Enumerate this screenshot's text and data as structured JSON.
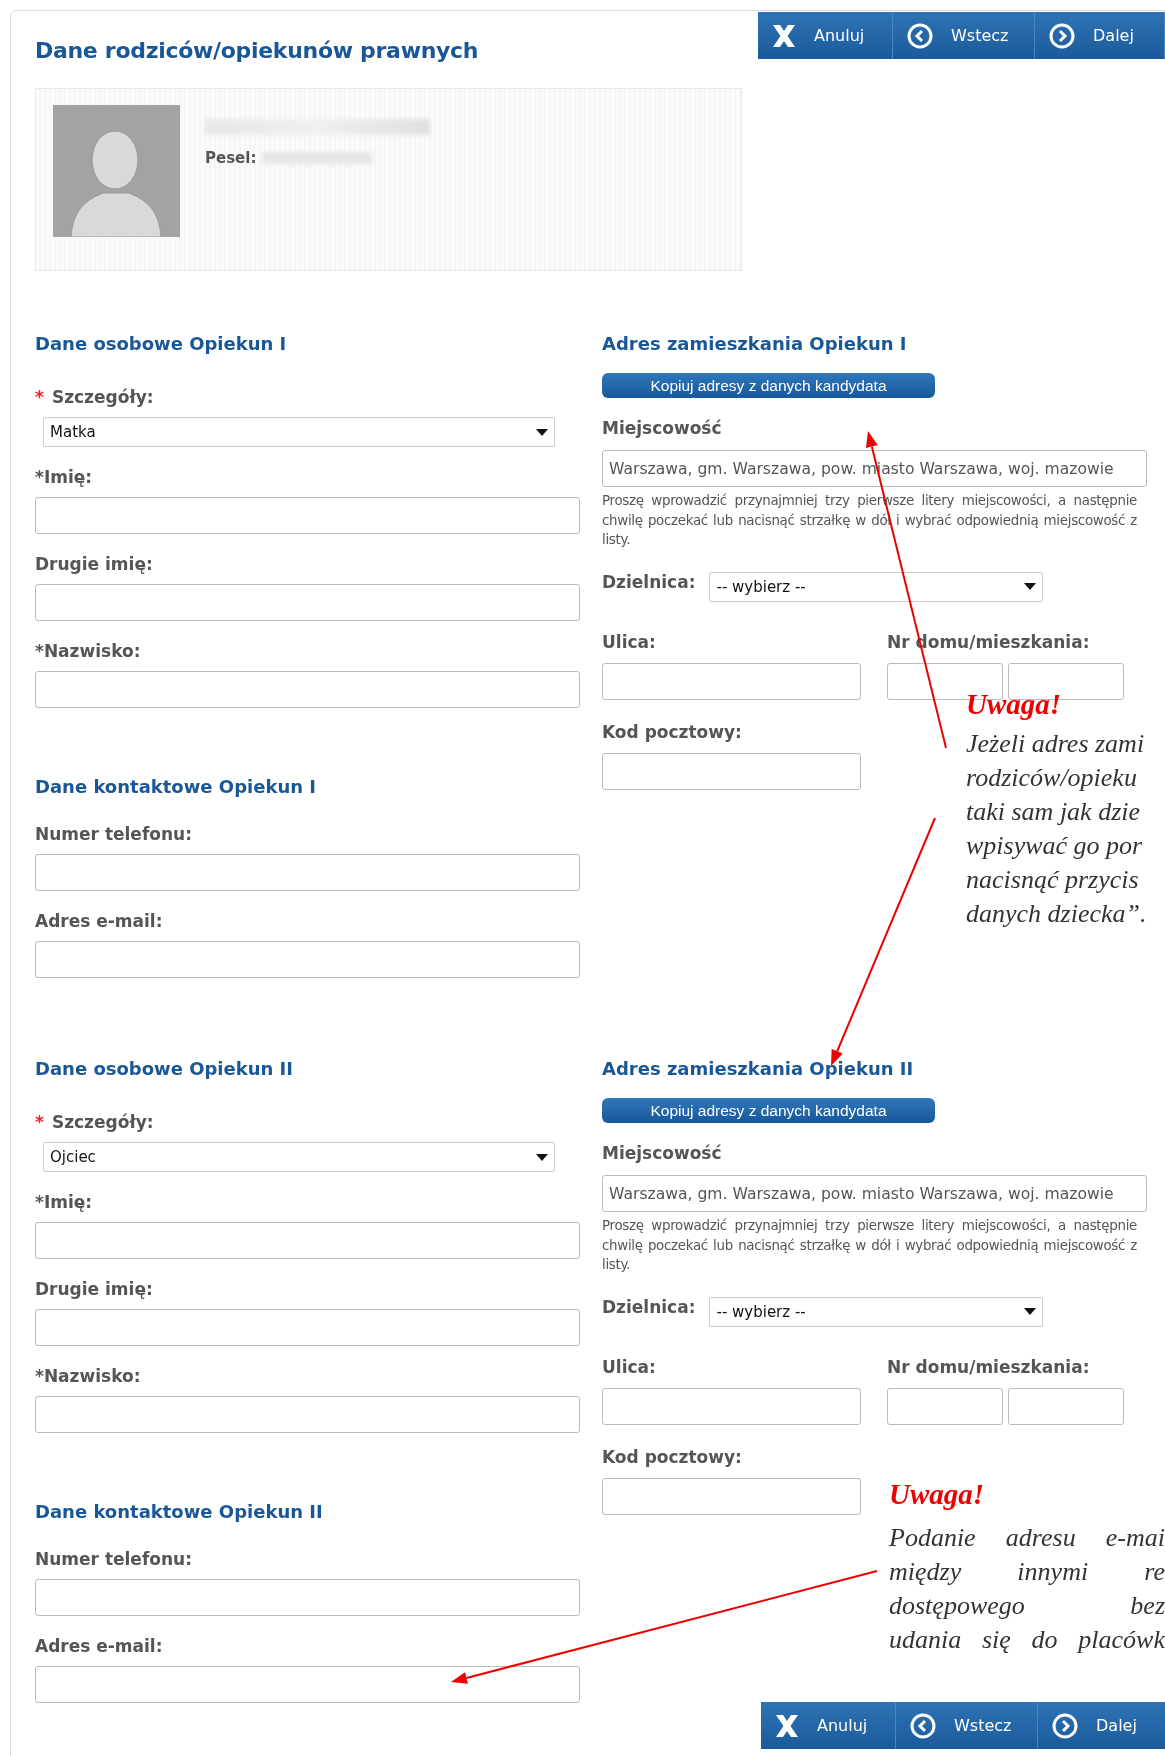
{
  "toolbar_top": [
    {
      "kind": "cancel",
      "label": "Anuluj"
    },
    {
      "kind": "back",
      "label": "Wstecz"
    },
    {
      "kind": "next",
      "label": "Dalej"
    }
  ],
  "title": "Dane rodziców/opiekunów prawnych",
  "candidate": {
    "pesel_label": "Pesel:"
  },
  "guardians": [
    {
      "personal": {
        "heading": "Dane osobowe Opiekun I",
        "fields": [
          {
            "kind": "select",
            "marker": "*",
            "label": "Szczegóły:",
            "value": "Matka"
          },
          {
            "kind": "text",
            "label": "*Imię:"
          },
          {
            "kind": "text",
            "label": "Drugie imię:"
          },
          {
            "kind": "text",
            "label": "*Nazwisko:"
          }
        ]
      },
      "contact": {
        "heading": "Dane kontaktowe Opiekun I",
        "fields": [
          {
            "kind": "text",
            "label": "Numer telefonu:"
          },
          {
            "kind": "text",
            "label": "Adres e-mail:"
          }
        ]
      },
      "address": {
        "heading": "Adres zamieszkania Opiekun I",
        "copy_button": "Kopiuj adresy z danych kandydata",
        "city_label": "Miejscowość",
        "city_value": "Warszawa, gm. Warszawa, pow. miasto Warszawa, woj. mazowie",
        "city_hint": "Proszę wprowadzić przynajmniej trzy pierwsze litery miejscowości, a następnie chwilę poczekać lub nacisnąć strzałkę w dół i wybrać odpowiednią miejscowość z listy.",
        "district_label": "Dzielnica:",
        "district_value": "-- wybierz --",
        "street_label": "Ulica:",
        "house_label": "Nr domu/mieszkania:",
        "postal_label": "Kod pocztowy:"
      }
    },
    {
      "personal": {
        "heading": "Dane osobowe Opiekun II",
        "fields": [
          {
            "kind": "select",
            "marker": "*",
            "label": "Szczegóły:",
            "value": "Ojciec"
          },
          {
            "kind": "text",
            "label": "*Imię:"
          },
          {
            "kind": "text",
            "label": "Drugie imię:"
          },
          {
            "kind": "text",
            "label": "*Nazwisko:"
          }
        ]
      },
      "contact": {
        "heading": "Dane kontaktowe Opiekun II",
        "fields": [
          {
            "kind": "text",
            "label": "Numer telefonu:"
          },
          {
            "kind": "text",
            "label": "Adres e-mail:"
          }
        ]
      },
      "address": {
        "heading": "Adres zamieszkania Opiekun II",
        "copy_button": "Kopiuj adresy z danych kandydata",
        "city_label": "Miejscowość",
        "city_value": "Warszawa, gm. Warszawa, pow. miasto Warszawa, woj. mazowie",
        "city_hint": "Proszę wprowadzić przynajmniej trzy pierwsze litery miejscowości, a następnie chwilę poczekać lub nacisnąć strzałkę w dół i wybrać odpowiednią miejscowość z listy.",
        "district_label": "Dzielnica:",
        "district_value": "-- wybierz --",
        "street_label": "Ulica:",
        "house_label": "Nr domu/mieszkania:",
        "postal_label": "Kod pocztowy:"
      }
    }
  ],
  "annotations": [
    {
      "title": "Uwaga!",
      "justified": false,
      "lines": [
        "Jeżeli adres zami",
        "rodziców/opieku",
        "taki sam jak dzie",
        "wpisywać go por",
        "nacisnąć przycis",
        "danych dziecka”."
      ]
    },
    {
      "title": "Uwaga!",
      "justified": true,
      "lines": [
        "Podanie adresu e-mai",
        "między innymi re",
        "dostępowego bez",
        "udania się  do placówk"
      ]
    }
  ],
  "toolbar_bottom": [
    {
      "kind": "cancel",
      "label": "Anuluj"
    },
    {
      "kind": "back",
      "label": "Wstecz"
    },
    {
      "kind": "next",
      "label": "Dalej"
    }
  ]
}
